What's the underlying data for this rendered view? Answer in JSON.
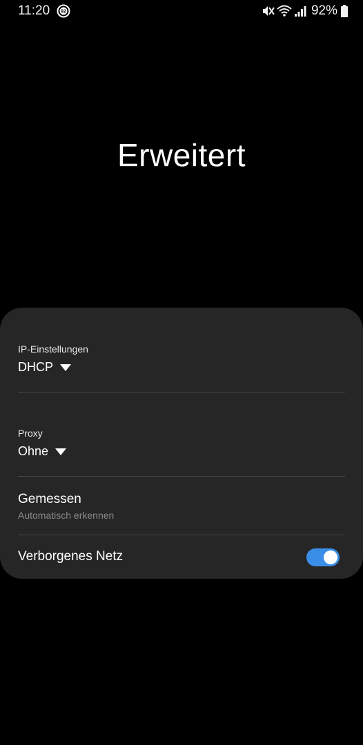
{
  "status_bar": {
    "time": "11:20",
    "notification_badge": "92",
    "battery_percent": "92%",
    "icons": [
      "mute-icon",
      "wifi-icon",
      "signal-icon",
      "battery-icon"
    ]
  },
  "page": {
    "title": "Erweitert"
  },
  "settings": {
    "ip_settings": {
      "label": "IP-Einstellungen",
      "value": "DHCP"
    },
    "proxy": {
      "label": "Proxy",
      "value": "Ohne"
    },
    "metered": {
      "title": "Gemessen",
      "subtitle": "Automatisch erkennen"
    },
    "hidden_network": {
      "title": "Verborgenes Netz",
      "enabled": true
    }
  },
  "colors": {
    "background": "#000000",
    "card": "#262626",
    "accent": "#3a8ee8",
    "divider": "#474747",
    "secondary_text": "#8a8a8a"
  }
}
